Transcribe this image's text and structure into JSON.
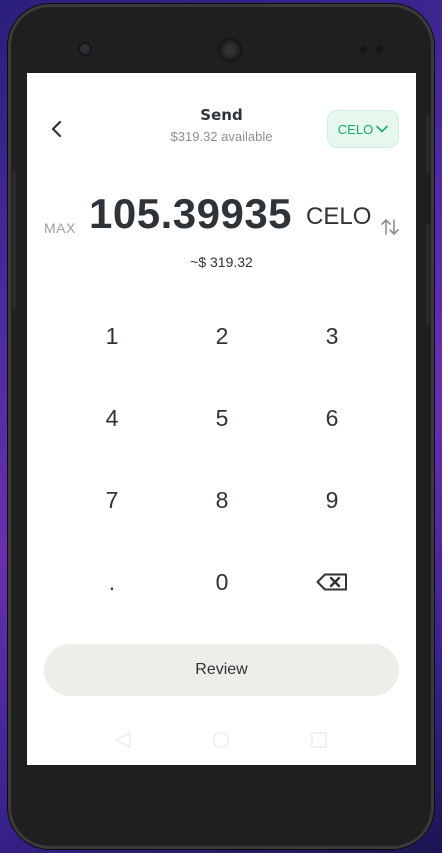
{
  "header": {
    "title": "Send",
    "available": "$319.32 available"
  },
  "token_selector": {
    "label": "CELO"
  },
  "amount": {
    "max_label": "MAX",
    "value": "105.39935",
    "unit": "CELO",
    "fiat": "~$ 319.32"
  },
  "keypad": {
    "keys": [
      "1",
      "2",
      "3",
      "4",
      "5",
      "6",
      "7",
      "8",
      "9",
      ".",
      "0"
    ]
  },
  "review": {
    "label": "Review"
  },
  "colors": {
    "token_bg": "#e6f7ee",
    "token_text": "#1aab6a",
    "review_bg": "#efede7",
    "text": "#2e3338"
  }
}
